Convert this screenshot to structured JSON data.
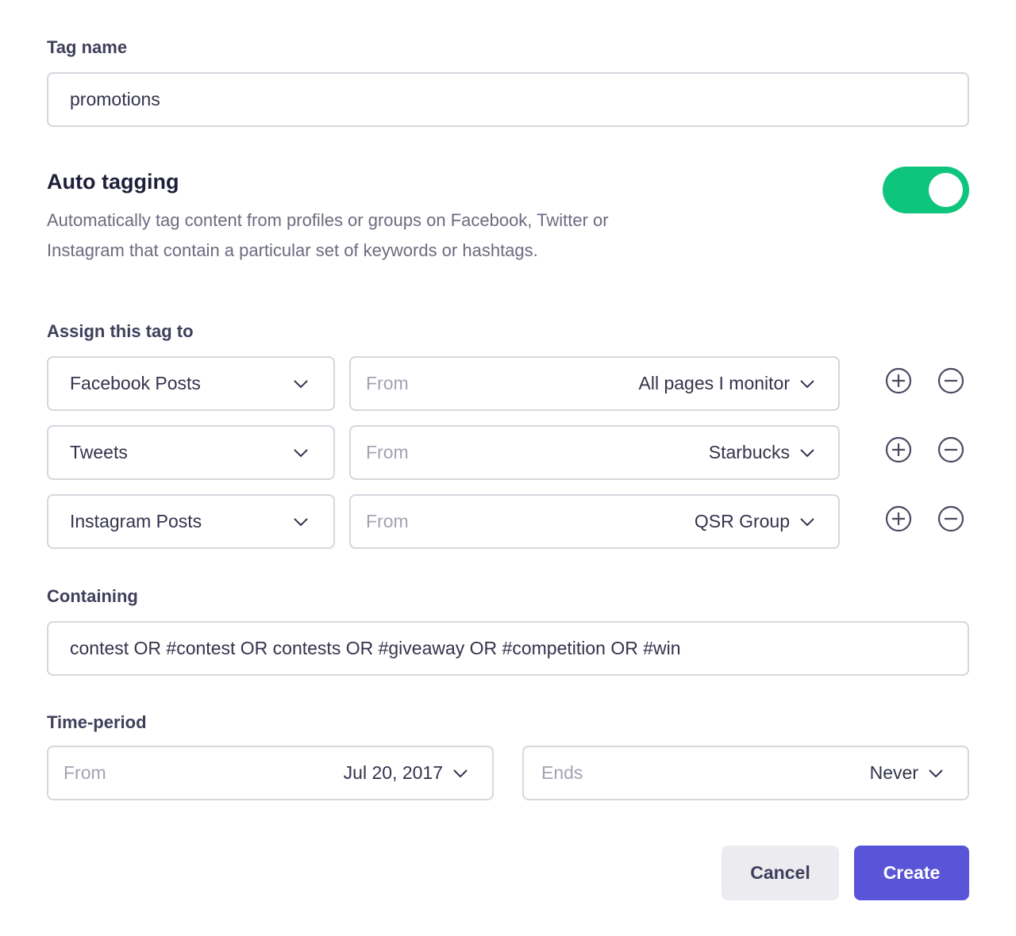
{
  "tag_name": {
    "label": "Tag name",
    "value": "promotions"
  },
  "auto_tagging": {
    "title": "Auto tagging",
    "description": "Automatically tag content from profiles or groups on Facebook, Twitter or Instagram that contain a particular set of keywords or hashtags.",
    "enabled": true,
    "toggle_color": "#0ec57d"
  },
  "assign": {
    "label": "Assign this tag to",
    "rows": [
      {
        "type": "Facebook Posts",
        "from_label": "From",
        "source": "All pages I monitor"
      },
      {
        "type": "Tweets",
        "from_label": "From",
        "source": "Starbucks"
      },
      {
        "type": "Instagram Posts",
        "from_label": "From",
        "source": "QSR Group"
      }
    ],
    "add_icon": "plus-circle-icon",
    "remove_icon": "minus-circle-icon"
  },
  "containing": {
    "label": "Containing",
    "value": "contest OR #contest OR contests OR #giveaway OR #competition OR #win"
  },
  "time_period": {
    "label": "Time-period",
    "from_label": "From",
    "from_value": "Jul 20, 2017",
    "ends_label": "Ends",
    "ends_value": "Never"
  },
  "actions": {
    "cancel": "Cancel",
    "create": "Create",
    "primary_color": "#5a55d8"
  }
}
